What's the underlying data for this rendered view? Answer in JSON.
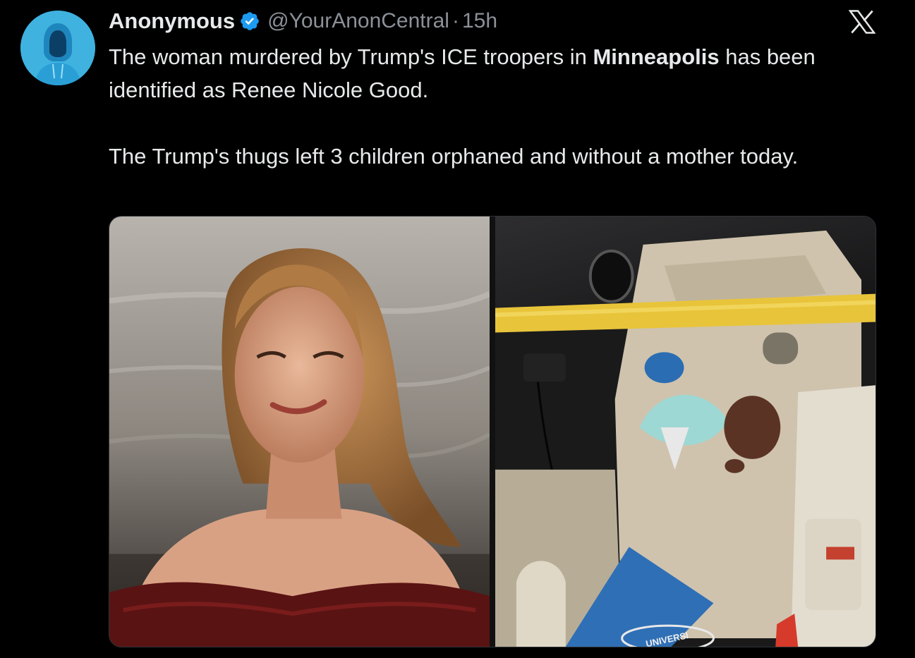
{
  "tweet": {
    "display_name": "Anonymous",
    "handle": "@YourAnonCentral",
    "separator": "·",
    "time": "15h",
    "text_line1_pre": "The woman murdered by Trump's ICE troopers in ",
    "text_line1_bold": "Minneapolis",
    "text_line1_post": " has been identified as Renee Nicole Good.",
    "text_para2": "The Trump's thugs left 3 children orphaned and without a mother today."
  },
  "media": {
    "left_photo": "woman-portrait-photo",
    "right_photo": "car-interior-photo",
    "right_photo_printed_text": "UNIVERSI"
  },
  "icons": {
    "verified": "verified-badge-icon",
    "brand": "x-logo-icon"
  },
  "colors": {
    "background": "#000000",
    "text": "#e7e9ea",
    "muted": "#8b9198",
    "verified": "#1d9bf0",
    "avatar": "#43b8e4"
  }
}
